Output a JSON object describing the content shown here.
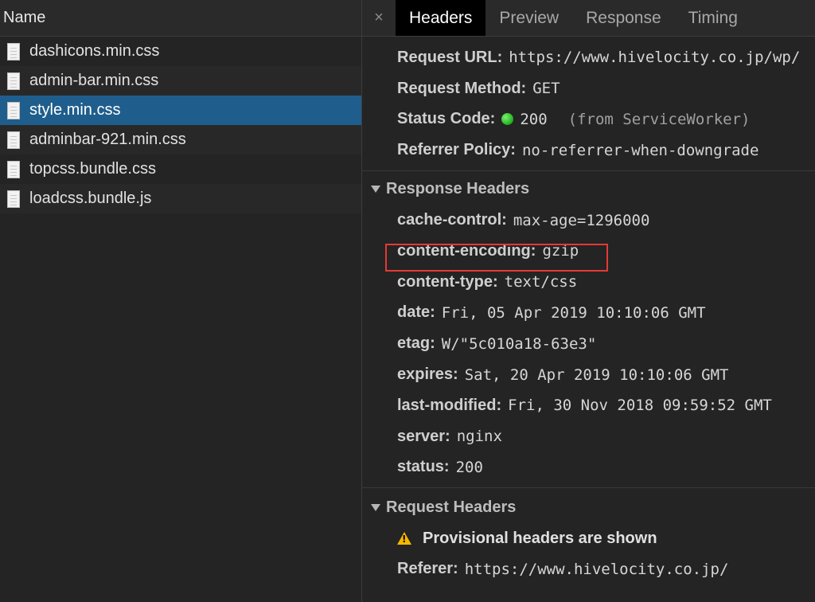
{
  "left_panel": {
    "header": "Name",
    "files": [
      {
        "name": "dashicons.min.css",
        "selected": false
      },
      {
        "name": "admin-bar.min.css",
        "selected": false
      },
      {
        "name": "style.min.css",
        "selected": true
      },
      {
        "name": "adminbar-921.min.css",
        "selected": false
      },
      {
        "name": "topcss.bundle.css",
        "selected": false
      },
      {
        "name": "loadcss.bundle.js",
        "selected": false
      }
    ]
  },
  "tabs": {
    "close": "×",
    "items": [
      "Headers",
      "Preview",
      "Response",
      "Timing"
    ],
    "active": "Headers"
  },
  "general": {
    "request_url_key": "Request URL:",
    "request_url_value": "https://www.hivelocity.co.jp/wp/",
    "request_method_key": "Request Method:",
    "request_method_value": "GET",
    "status_code_key": "Status Code:",
    "status_code_value": "200",
    "status_code_note": "(from ServiceWorker)",
    "referrer_policy_key": "Referrer Policy:",
    "referrer_policy_value": "no-referrer-when-downgrade"
  },
  "response_headers": {
    "title": "Response Headers",
    "items": [
      {
        "key": "cache-control:",
        "value": "max-age=1296000"
      },
      {
        "key": "content-encoding:",
        "value": "gzip"
      },
      {
        "key": "content-type:",
        "value": "text/css"
      },
      {
        "key": "date:",
        "value": "Fri, 05 Apr 2019 10:10:06 GMT"
      },
      {
        "key": "etag:",
        "value": "W/\"5c010a18-63e3\""
      },
      {
        "key": "expires:",
        "value": "Sat, 20 Apr 2019 10:10:06 GMT"
      },
      {
        "key": "last-modified:",
        "value": "Fri, 30 Nov 2018 09:59:52 GMT"
      },
      {
        "key": "server:",
        "value": "nginx"
      },
      {
        "key": "status:",
        "value": "200"
      }
    ]
  },
  "request_headers": {
    "title": "Request Headers",
    "warning": "Provisional headers are shown",
    "referer_key": "Referer:",
    "referer_value": "https://www.hivelocity.co.jp/"
  },
  "colors": {
    "selected_row": "#1f5e8c",
    "highlight_box": "#e53935",
    "status_dot": "#2ecc40",
    "warning_icon": "#f5b800"
  }
}
